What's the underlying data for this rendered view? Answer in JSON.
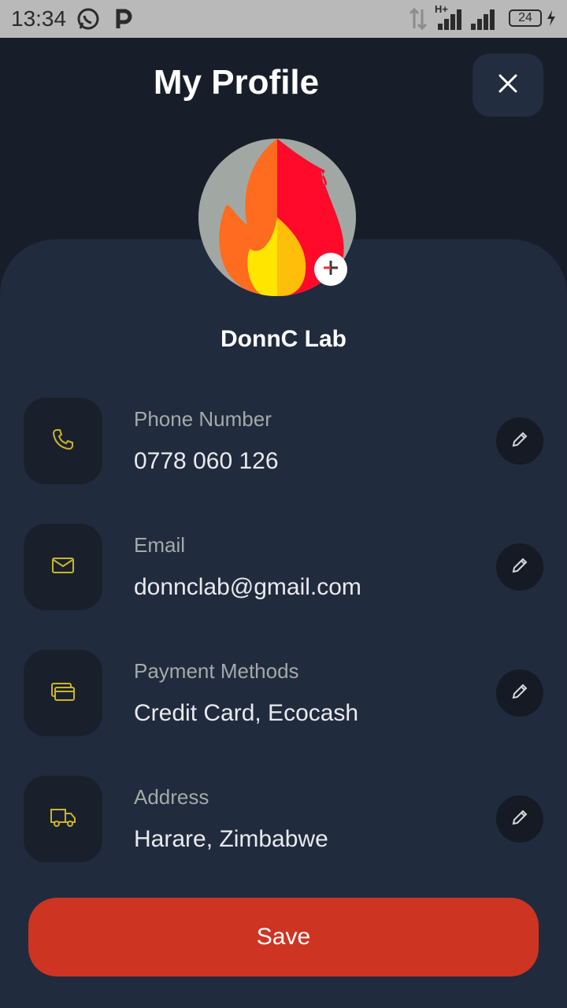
{
  "status_bar": {
    "time": "13:34",
    "battery": "24",
    "network": "H+",
    "icons": [
      "whatsapp-icon",
      "p-app-icon",
      "data-arrows-icon",
      "signal-icon",
      "battery-icon"
    ]
  },
  "header": {
    "title": "My Profile",
    "close_icon": "close-icon"
  },
  "profile": {
    "name": "DonnC Lab",
    "avatar_icon": "flame-icon",
    "add_photo_icon": "plus-icon"
  },
  "fields": [
    {
      "label": "Phone Number",
      "value": "0778 060 126",
      "icon": "phone-icon"
    },
    {
      "label": "Email",
      "value": "donnclab@gmail.com",
      "icon": "mail-icon"
    },
    {
      "label": "Payment Methods",
      "value": "Credit Card, Ecocash",
      "icon": "cards-icon"
    },
    {
      "label": "Address",
      "value": "Harare, Zimbabwe",
      "icon": "truck-icon"
    }
  ],
  "actions": {
    "save": "Save"
  },
  "colors": {
    "background": "#181e29",
    "sheet": "#212b3e",
    "accent": "#cd3422",
    "icon_yellow": "#c9b52a"
  }
}
